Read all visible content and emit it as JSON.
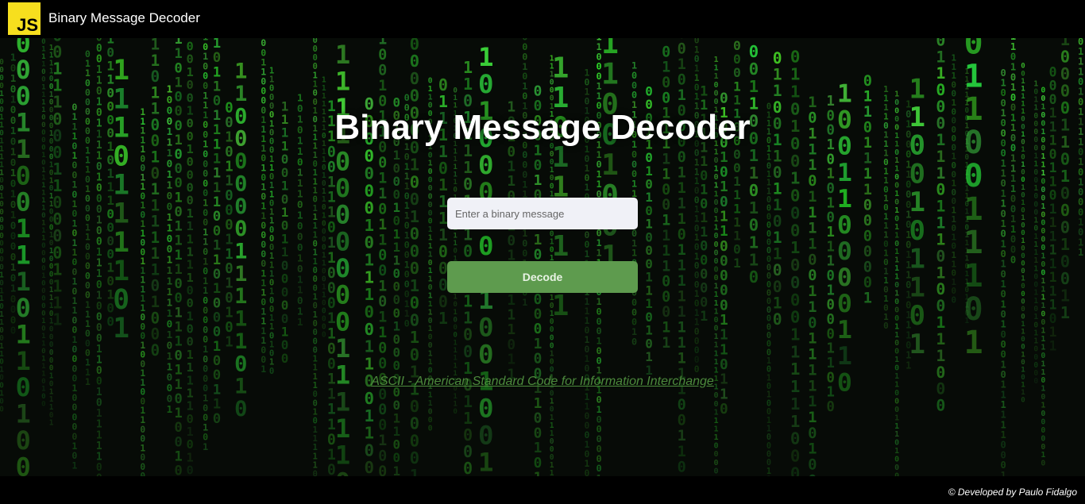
{
  "header": {
    "logo_text": "JS",
    "logo_color": "#f7df1e",
    "app_title": "Binary Message Decoder"
  },
  "main": {
    "title": "Binary Message Decoder",
    "input": {
      "value": "",
      "placeholder": "Enter a binary message"
    },
    "decode_button_label": "Decode",
    "ascii_link_text": "ASCII - American Standard Code for Information Interchange"
  },
  "footer": {
    "credit": "© Developed by Paulo Fidalgo"
  },
  "theme": {
    "background": "matrix-binary-rain",
    "accent_green": "#5e9b4e",
    "rain_green": "#39e23a"
  }
}
